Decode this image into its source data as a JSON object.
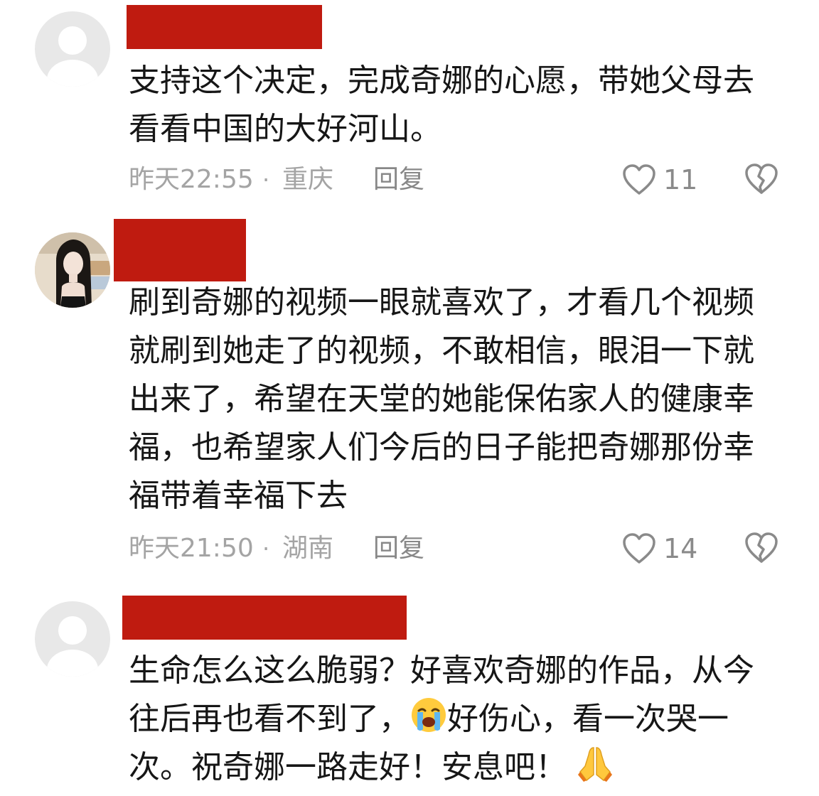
{
  "comments": [
    {
      "avatar": "default-avatar",
      "username_redacted": true,
      "text": "支持这个决定，完成奇娜的心愿，带她父母去看看中国的大好河山。",
      "time": "昨天22:55",
      "separator": "·",
      "region": "重庆",
      "reply_label": "回复",
      "likes": "11"
    },
    {
      "avatar": "photo-avatar",
      "username_redacted": true,
      "text": "刷到奇娜的视频一眼就喜欢了，才看几个视频就刷到她走了的视频，不敢相信，眼泪一下就出来了，希望在天堂的她能保佑家人的健康幸福，也希望家人们今后的日子能把奇娜那份幸福带着幸福下去",
      "time": "昨天21:50",
      "separator": "·",
      "region": "湖南",
      "reply_label": "回复",
      "likes": "14"
    },
    {
      "avatar": "default-avatar",
      "username_redacted": true,
      "text_part1": "生命怎么这么脆弱？好喜欢奇娜的作品，从今往后再也看不到了，",
      "emoji1": "crying-face-emoji",
      "text_part2": "好伤心，看一次哭一次。祝奇娜一路走好！安息吧！",
      "emoji2": "folded-hands-emoji"
    }
  ],
  "icons": {
    "like": "heart-outline-icon",
    "dislike": "broken-heart-icon"
  },
  "colors": {
    "redaction": "#bf1b10",
    "text": "#161616",
    "meta": "#a4a4a4"
  }
}
